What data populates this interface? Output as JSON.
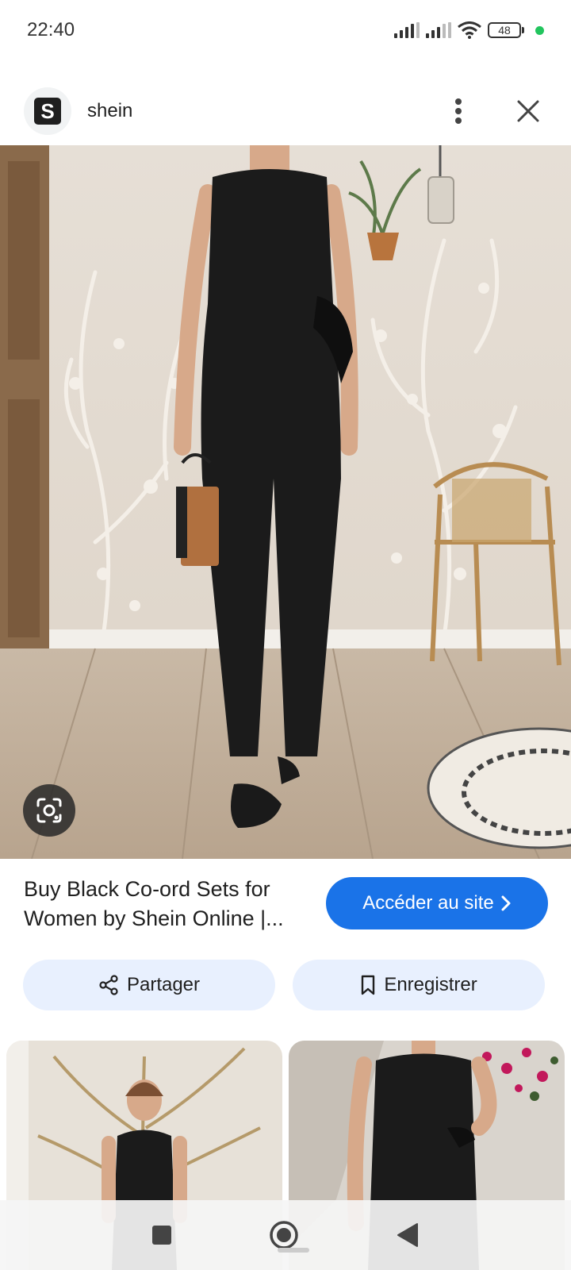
{
  "status_bar": {
    "time": "22:40",
    "battery": "48",
    "icons": [
      "signal-icon",
      "signal-icon",
      "wifi-icon",
      "battery-icon",
      "privacy-dot-icon"
    ]
  },
  "header": {
    "site_logo_letter": "S",
    "site_name": "shein",
    "icons": [
      "more-vert-icon",
      "close-icon"
    ]
  },
  "main_image": {
    "icon": "lens-search-icon"
  },
  "result": {
    "title": "Buy Black Co-ord Sets for Women by Shein Online |...",
    "visit_label": "Accéder au site",
    "visit_icon": "chevron-right-icon"
  },
  "actions": {
    "share_label": "Partager",
    "share_icon": "share-icon",
    "save_label": "Enregistrer",
    "save_icon": "bookmark-icon"
  },
  "nav": {
    "icons": [
      "recent-apps-icon",
      "home-icon",
      "back-icon"
    ]
  },
  "colors": {
    "accent": "#1a73e8",
    "action_bg": "#e8f0fe"
  }
}
